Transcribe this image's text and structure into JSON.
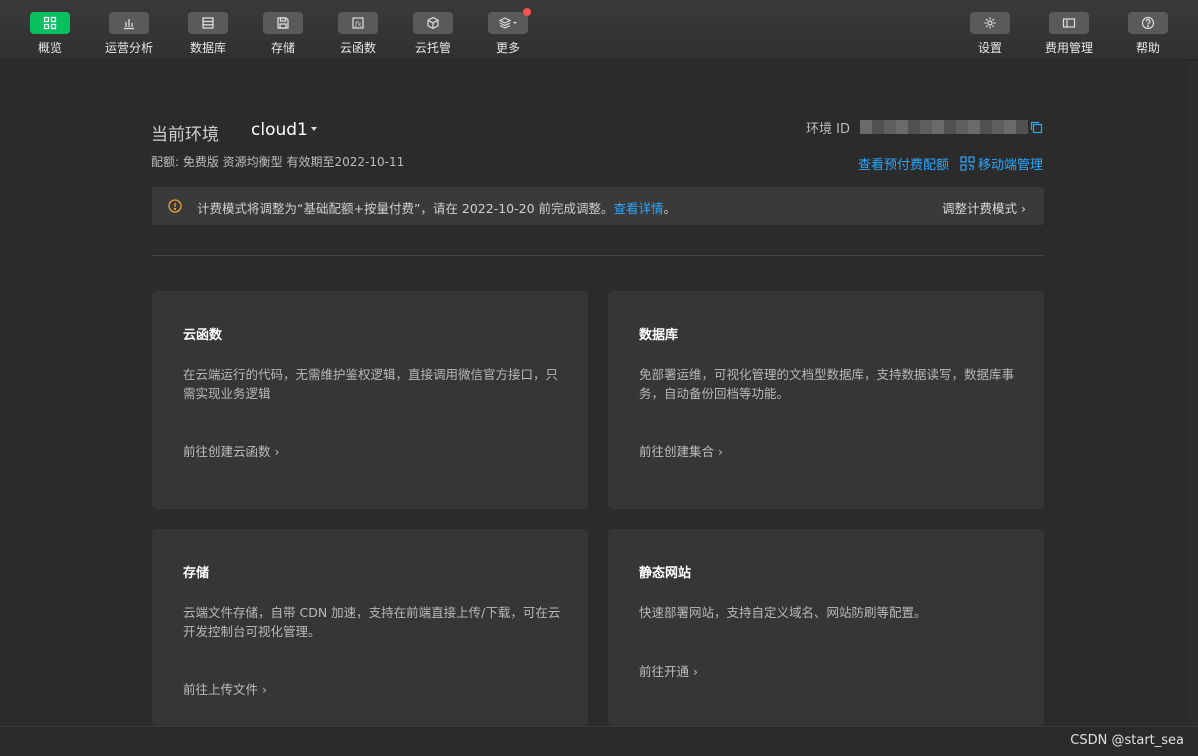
{
  "toolbar": {
    "items": [
      {
        "label": "概览",
        "icon": "grid-icon",
        "active": true
      },
      {
        "label": "运营分析",
        "icon": "bar-chart-icon"
      },
      {
        "label": "数据库",
        "icon": "database-icon"
      },
      {
        "label": "存储",
        "icon": "save-icon"
      },
      {
        "label": "云函数",
        "icon": "function-icon"
      },
      {
        "label": "云托管",
        "icon": "cube-icon"
      },
      {
        "label": "更多",
        "icon": "layers-icon",
        "badge": true
      }
    ],
    "right_items": [
      {
        "label": "设置",
        "icon": "gear-icon"
      },
      {
        "label": "费用管理",
        "icon": "billing-icon"
      },
      {
        "label": "帮助",
        "icon": "help-icon"
      }
    ]
  },
  "env": {
    "label": "当前环境",
    "name": "cloud1",
    "quota": "配额: 免费版 资源均衡型 有效期至2022-10-11",
    "id_label": "环境 ID",
    "prepaid_link": "查看预付费配额",
    "mobile_link": "移动端管理"
  },
  "notice": {
    "message": "计费模式将调整为“基础配额+按量付费”，请在 2022-10-20 前完成调整。",
    "link": "查看详情",
    "suffix": "。",
    "action": "调整计费模式"
  },
  "cards": [
    {
      "title": "云函数",
      "desc": "在云端运行的代码，无需维护鉴权逻辑，直接调用微信官方接口，只需实现业务逻辑",
      "link": "前往创建云函数"
    },
    {
      "title": "数据库",
      "desc": "免部署运维，可视化管理的文档型数据库，支持数据读写，数据库事务，自动备份回档等功能。",
      "link": "前往创建集合"
    },
    {
      "title": "存储",
      "desc": "云端文件存储，自带 CDN 加速，支持在前端直接上传/下载，可在云开发控制台可视化管理。",
      "link": "前往上传文件"
    },
    {
      "title": "静态网站",
      "desc": "快速部署网站，支持自定义域名、网站防刷等配置。",
      "link": "前往开通"
    }
  ],
  "watermark": "CSDN @start_sea",
  "colors": {
    "accent": "#07c160",
    "link": "#2aa8ff",
    "warning": "#e6a23c",
    "badge": "#fa5151"
  }
}
